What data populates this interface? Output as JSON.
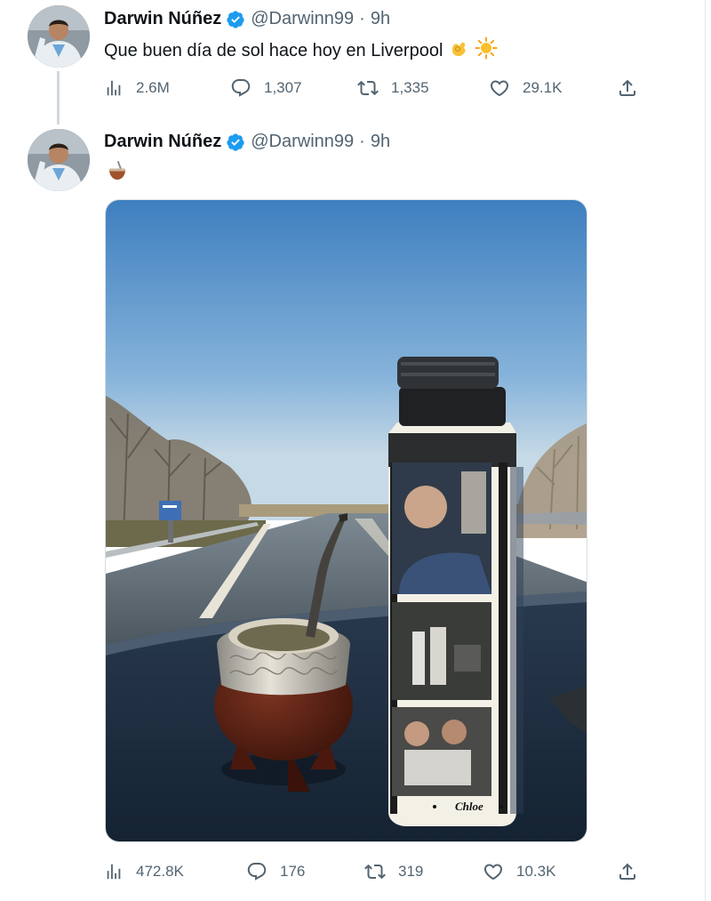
{
  "tweets": [
    {
      "name": "Darwin Núñez",
      "handle": "@Darwinn99",
      "separator": "·",
      "time": "9h",
      "text": "Que buen día de sol hace hoy en Liverpool",
      "emojis": [
        "ok-hand-emoji",
        "sun-emoji"
      ],
      "views": "2.6M",
      "replies": "1,307",
      "retweets": "1,335",
      "likes": "29.1K"
    },
    {
      "name": "Darwin Núñez",
      "handle": "@Darwinn99",
      "separator": "·",
      "time": "9h",
      "emojis": [
        "mate-emoji"
      ],
      "photo": {
        "thermos_label": "Chloe"
      },
      "views": "472.8K",
      "replies": "176",
      "retweets": "319",
      "likes": "10.3K"
    }
  ],
  "colors": {
    "verified": "#1d9bf0",
    "text": "#0f1419",
    "muted": "#536471"
  },
  "icons": [
    "verified-badge-icon",
    "views-icon",
    "reply-icon",
    "retweet-icon",
    "like-icon",
    "share-icon"
  ]
}
